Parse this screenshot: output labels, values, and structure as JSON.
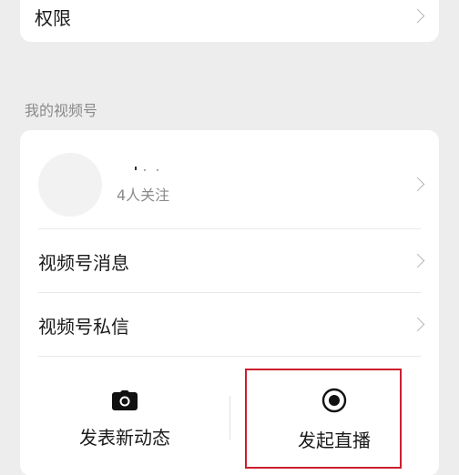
{
  "top_card": {
    "permissions_label": "权限"
  },
  "section": {
    "title": "我的视频号"
  },
  "profile": {
    "followers_text": "4人关注"
  },
  "menu": {
    "channel_messages": "视频号消息",
    "channel_dm": "视频号私信"
  },
  "actions": {
    "post_label": "发表新动态",
    "live_label": "发起直播"
  },
  "icons": {
    "chevron": "chevron-right-icon",
    "camera": "camera-icon",
    "live": "record-icon"
  },
  "colors": {
    "highlight": "#cc1f2e",
    "background": "#ededed",
    "card": "#ffffff"
  }
}
